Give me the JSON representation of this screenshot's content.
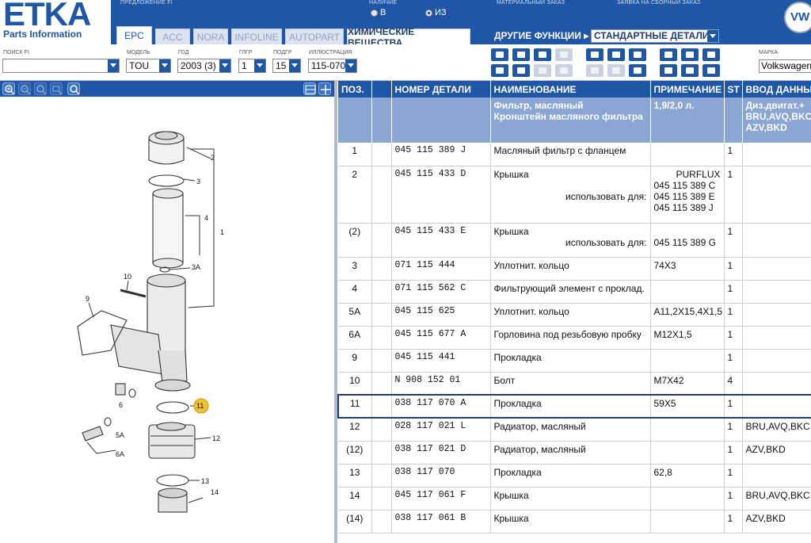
{
  "header": {
    "logo": "ETKA",
    "logo_sub": "Parts Information",
    "offer_label": "ПРЕДЛОЖЕНИЕ FI",
    "availability_label": "НАЛИЧИЕ",
    "radio_b": "В",
    "radio_iz": "ИЗ",
    "material_order_label": "МАТЕРИАЛЬНЫЙ ЗАКАЗ",
    "assembly_request_label": "ЗАЯВКА НА СБОРНЫЙ ЗАКАЗ",
    "tabs": [
      "EPC",
      "ACC",
      "NORA",
      "INFOLINE",
      "AUTOPART",
      "ХИМИЧЕСКИЕ ВЕЩЕСТВА"
    ],
    "other_functions": "ДРУГИЕ ФУНКЦИИ ▸",
    "standard_parts": "СТАНДАРТНЫЕ ДЕТАЛИ"
  },
  "filters": {
    "search_label": "ПОИСК FI",
    "search_value": "",
    "model_label": "МОДЕЛЬ",
    "model_value": "TOU",
    "year_label": "ГОД",
    "year_value": "2003 (3)",
    "main_group_label": "ГЛГР",
    "main_group_value": "1",
    "sub_group_label": "ПОДГР",
    "sub_group_value": "15",
    "illustration_label": "ИЛЛЮСТРАЦИЯ",
    "illustration_value": "115-070",
    "brand_label": "МАРКА",
    "brand_value": "Volkswagen"
  },
  "diagram": {
    "callouts": [
      "1",
      "2",
      "3",
      "3A",
      "4",
      "5A",
      "6",
      "6A",
      "9",
      "10",
      "11",
      "12",
      "13",
      "14"
    ],
    "highlighted_callout": "11"
  },
  "table": {
    "columns": [
      "ПОЗ.",
      "",
      "НОМЕР ДЕТАЛИ",
      "НАИМЕНОВАНИЕ",
      "ПРИМЕЧАНИЕ",
      "ST",
      "ВВОД ДАННЫХ"
    ],
    "info": {
      "name_line1": "Фильтр, масляный",
      "name_line2": "Кронштейн масляного фильтра",
      "note": "1,9/2,0 л.",
      "data_line1": "Диз.двигат.+",
      "data_line2": "BRU,AVQ,BKC,",
      "data_line3": "AZV,BKD"
    },
    "rows": [
      {
        "pos": "1",
        "part": "045 115 389 J",
        "name": "Масляный фильтр с фланцем",
        "note": "",
        "st": "1",
        "data": ""
      },
      {
        "pos": "2",
        "part": "045 115 433 D",
        "name": "Крышка",
        "use_for": "использовать для:",
        "note_brand": "PURFLUX",
        "note_lines": [
          "045 115 389 C",
          "045 115 389 E",
          "045 115 389 J"
        ],
        "st": "1",
        "data": ""
      },
      {
        "pos": "(2)",
        "part": "045 115 433 E",
        "name": "Крышка",
        "use_for": "использовать для:",
        "note": "045 115 389 G",
        "st": "1",
        "data": ""
      },
      {
        "pos": "3",
        "part": "071 115 444",
        "name": "Уплотнит. кольцо",
        "note": "74X3",
        "st": "1",
        "data": ""
      },
      {
        "pos": "4",
        "part": "071 115 562 C",
        "name": "Фильтрующий элемент с проклад.",
        "note": "",
        "st": "1",
        "data": ""
      },
      {
        "pos": "5A",
        "part": "045 115 625",
        "name": "Уплотнит. кольцо",
        "note": "A11,2X15,4X1,5",
        "st": "1",
        "data": ""
      },
      {
        "pos": "6A",
        "part": "045 115 677 A",
        "name": "Горловина под резьбовую пробку",
        "note": "M12X1,5",
        "st": "1",
        "data": ""
      },
      {
        "pos": "9",
        "part": "045 115 441",
        "name": "Прокладка",
        "note": "",
        "st": "1",
        "data": ""
      },
      {
        "pos": "10",
        "part": "N 908 152 01",
        "name": "Болт",
        "note": "M7X42",
        "st": "4",
        "data": ""
      },
      {
        "pos": "11",
        "part": "038 117 070 A",
        "name": "Прокладка",
        "note": "59X5",
        "st": "1",
        "data": ""
      },
      {
        "pos": "12",
        "part": "028 117 021 L",
        "name": "Радиатор, масляный",
        "note": "",
        "st": "1",
        "data": "BRU,AVQ,BKC"
      },
      {
        "pos": "(12)",
        "part": "038 117 021 D",
        "name": "Радиатор, масляный",
        "note": "",
        "st": "1",
        "data": "AZV,BKD"
      },
      {
        "pos": "13",
        "part": "038 117 070",
        "name": "Прокладка",
        "note": "62,8",
        "st": "1",
        "data": ""
      },
      {
        "pos": "14",
        "part": "045 117 061 F",
        "name": "Крышка",
        "note": "",
        "st": "1",
        "data": "BRU,AVQ,BKC"
      },
      {
        "pos": "(14)",
        "part": "038 117 061 B",
        "name": "Крышка",
        "note": "",
        "st": "1",
        "data": "AZV,BKD"
      }
    ]
  },
  "colors": {
    "brand_blue": "#1f57a6",
    "info_row": "#8aa6d3",
    "highlight_callout": "#f2c12e"
  }
}
